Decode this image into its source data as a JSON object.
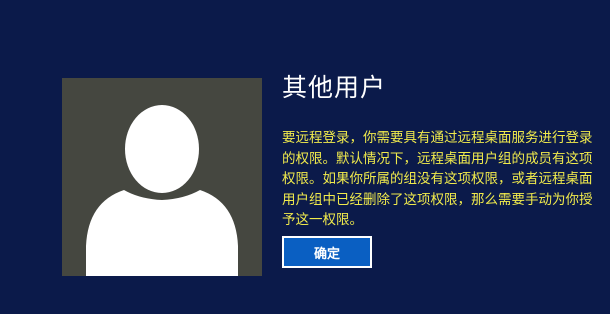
{
  "user": {
    "name": "其他用户",
    "avatar_icon": "user-silhouette-icon"
  },
  "dialog": {
    "message": "要远程登录，你需要具有通过远程桌面服务进行登录的权限。默认情况下，远程桌面用户组的成员有这项权限。如果你所属的组没有这项权限，或者远程桌面用户组中已经删除了这项权限，那么需要手动为你授予这一权限。",
    "ok_label": "确定"
  },
  "colors": {
    "background": "#0b1a4a",
    "avatar_background": "#454740",
    "avatar_silhouette": "#ffffff",
    "message_text": "#f0ea4c",
    "button_background": "#0a5fc2",
    "button_border": "#ffffff"
  }
}
